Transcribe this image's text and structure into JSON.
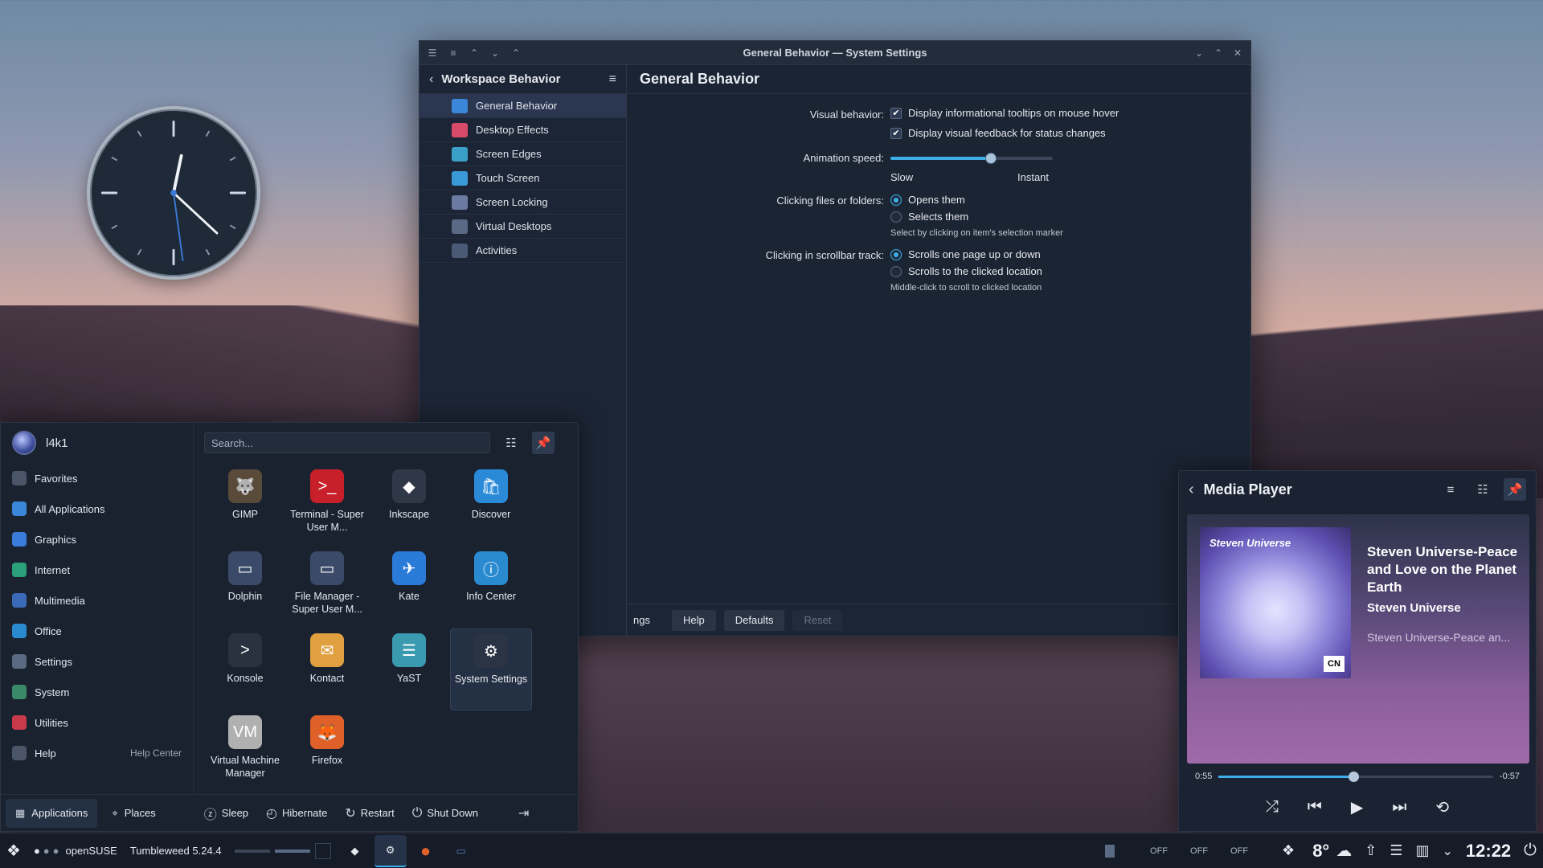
{
  "window": {
    "title": "General Behavior — System Settings",
    "sidebar_title": "Workspace Behavior",
    "sidebar_items": [
      {
        "label": "General Behavior",
        "color": "#3a86d8"
      },
      {
        "label": "Desktop Effects",
        "color": "#d84a6a"
      },
      {
        "label": "Screen Edges",
        "color": "#3aa0c8"
      },
      {
        "label": "Touch Screen",
        "color": "#3a9ad8"
      },
      {
        "label": "Screen Locking",
        "color": "#6a7aa0"
      },
      {
        "label": "Virtual Desktops",
        "color": "#5a6a86"
      },
      {
        "label": "Activities",
        "color": "#4a5a76"
      }
    ],
    "page_title": "General Behavior",
    "visual_behavior_label": "Visual behavior:",
    "tooltip_option": "Display informational tooltips on mouse hover",
    "feedback_option": "Display visual feedback for status changes",
    "animation_label": "Animation speed:",
    "animation_value": 0.62,
    "slow_label": "Slow",
    "instant_label": "Instant",
    "clicking_label": "Clicking files or folders:",
    "opens_option": "Opens them",
    "selects_option": "Selects them",
    "selects_hint": "Select by clicking on item's selection marker",
    "scrollbar_label": "Clicking in scrollbar track:",
    "scroll_page_option": "Scrolls one page up or down",
    "scroll_location_option": "Scrolls to the clicked location",
    "scroll_hint": "Middle-click to scroll to clicked location",
    "footer_partial": "ngs",
    "help_button": "Help",
    "defaults_button": "Defaults",
    "reset_button": "Reset"
  },
  "launcher": {
    "username": "l4k1",
    "search_placeholder": "Search...",
    "categories": [
      {
        "label": "Favorites",
        "color": "#4a5668"
      },
      {
        "label": "All Applications",
        "color": "#3a86d8"
      },
      {
        "label": "Graphics",
        "color": "#3a7ad8"
      },
      {
        "label": "Internet",
        "color": "#2aa07a"
      },
      {
        "label": "Multimedia",
        "color": "#3a6ab8"
      },
      {
        "label": "Office",
        "color": "#2a8ad0"
      },
      {
        "label": "Settings",
        "color": "#5a6a80"
      },
      {
        "label": "System",
        "color": "#3a8a6a"
      },
      {
        "label": "Utilities",
        "color": "#c83a4a"
      },
      {
        "label": "Help",
        "color": "#4a5668"
      }
    ],
    "help_center": "Help Center",
    "apps": [
      {
        "name": "GIMP",
        "icon": "🐺",
        "color": "#5a4a3a"
      },
      {
        "name": "Terminal - Super User M...",
        "icon": ">_",
        "color": "#c8202a"
      },
      {
        "name": "Inkscape",
        "icon": "◆",
        "color": "#303848"
      },
      {
        "name": "Discover",
        "icon": "🛍",
        "color": "#2a8ad8"
      },
      {
        "name": "Dolphin",
        "icon": "▭",
        "color": "#3a4a68"
      },
      {
        "name": "File Manager - Super User M...",
        "icon": "▭",
        "color": "#3a4a68"
      },
      {
        "name": "Kate",
        "icon": "✈",
        "color": "#2a7ad8"
      },
      {
        "name": "Info Center",
        "icon": "ⓘ",
        "color": "#2a8ad0"
      },
      {
        "name": "Konsole",
        "icon": ">",
        "color": "#2a3240"
      },
      {
        "name": "Kontact",
        "icon": "✉",
        "color": "#e0a040"
      },
      {
        "name": "YaST",
        "icon": "☰",
        "color": "#3a9ab0"
      },
      {
        "name": "System Settings",
        "icon": "⚙",
        "color": "#2a3444"
      },
      {
        "name": "Virtual Machine Manager",
        "icon": "VM",
        "color": "#b0b0b0"
      },
      {
        "name": "Firefox",
        "icon": "🦊",
        "color": "#e0602a"
      }
    ],
    "applications_tab": "Applications",
    "places_tab": "Places",
    "sleep": "Sleep",
    "hibernate": "Hibernate",
    "restart": "Restart",
    "shutdown": "Shut Down"
  },
  "media": {
    "title": "Media Player",
    "album_brand": "Steven Universe",
    "album_badge": "CN",
    "track": "Steven Universe-Peace and Love on the Planet Earth",
    "artist": "Steven Universe",
    "album": "Steven Universe-Peace an...",
    "elapsed": "0:55",
    "remaining": "-0:57",
    "position": 0.49
  },
  "taskbar": {
    "os_label": "openSUSE",
    "version": "Tumbleweed 5.24.4",
    "off1": "OFF",
    "off2": "OFF",
    "off3": "OFF",
    "temperature": "8°",
    "time": "12:22"
  }
}
